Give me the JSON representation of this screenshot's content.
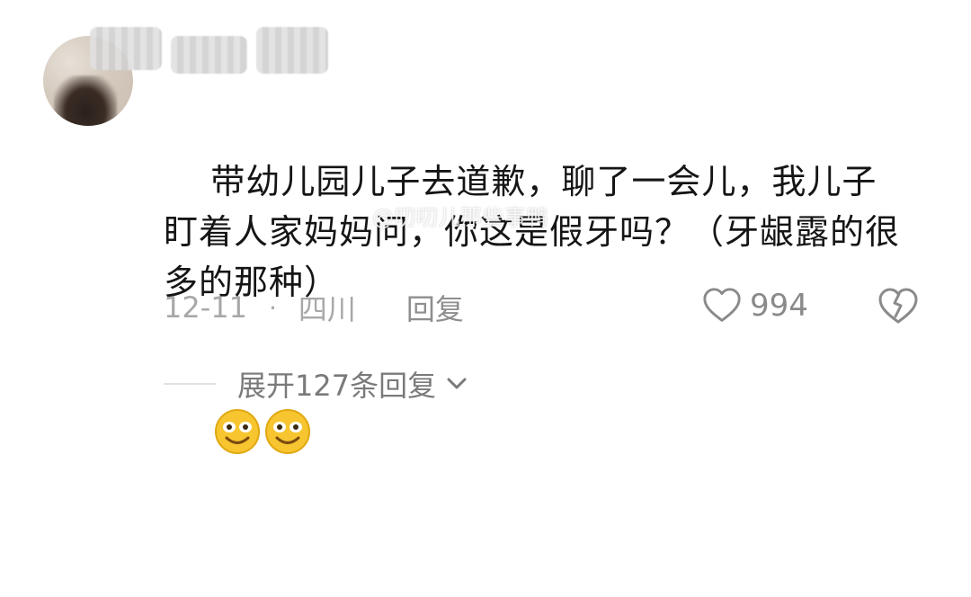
{
  "comment": {
    "text": "带幼儿园儿子去道歉，聊了一会儿，我儿子盯着人家妈妈问，你这是假牙吗？（牙龈露的很多的那种）",
    "emojis": [
      "smile-emoji",
      "smile-emoji"
    ],
    "watermark": "@叨叨儿那些事鸭",
    "date": "12-11",
    "separator": "·",
    "location": "四川",
    "reply_label": "回复",
    "like_count": "994",
    "expand_label": "展开127条回复"
  },
  "icons": {
    "like": "heart-outline-icon",
    "dislike": "broken-heart-icon",
    "expand": "chevron-down-icon"
  },
  "colors": {
    "text": "#151515",
    "meta": "#a8a8a8",
    "secondary": "#7a7a7a",
    "emoji_face": "#f7c52f"
  }
}
